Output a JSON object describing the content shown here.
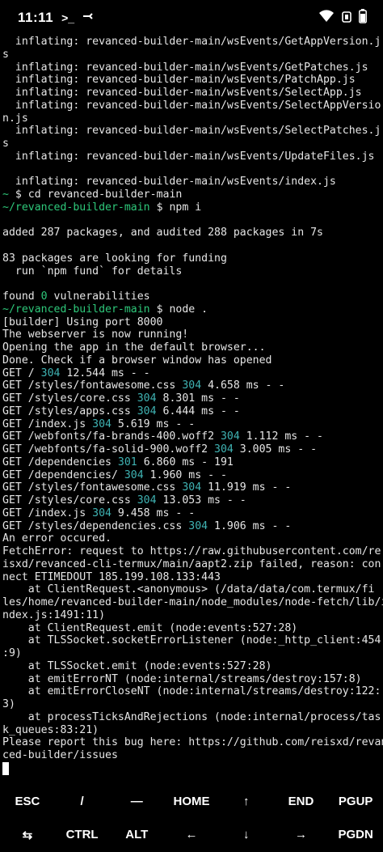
{
  "status_bar": {
    "time": "11:11",
    "indicators": ">_",
    "icons": [
      "terminal-icon",
      "cast-icon",
      "wifi-icon",
      "alarm-icon",
      "battery-icon"
    ]
  },
  "terminal": {
    "lines": [
      [
        {
          "t": "  inflating: revanced-builder-main/wsEvents/GetAppVersion.j"
        }
      ],
      [
        {
          "t": "s"
        }
      ],
      [
        {
          "t": "  inflating: revanced-builder-main/wsEvents/GetPatches.js"
        }
      ],
      [
        {
          "t": "  inflating: revanced-builder-main/wsEvents/PatchApp.js"
        }
      ],
      [
        {
          "t": "  inflating: revanced-builder-main/wsEvents/SelectApp.js"
        }
      ],
      [
        {
          "t": "  inflating: revanced-builder-main/wsEvents/SelectAppVersio"
        }
      ],
      [
        {
          "t": "n.js"
        }
      ],
      [
        {
          "t": "  inflating: revanced-builder-main/wsEvents/SelectPatches.j"
        }
      ],
      [
        {
          "t": "s"
        }
      ],
      [
        {
          "t": "  inflating: revanced-builder-main/wsEvents/UpdateFiles.js"
        }
      ],
      [
        {
          "t": ""
        }
      ],
      [
        {
          "t": "  inflating: revanced-builder-main/wsEvents/index.js"
        }
      ],
      [
        {
          "t": "~",
          "c": "green"
        },
        {
          "t": " $ cd revanced-builder-main"
        }
      ],
      [
        {
          "t": "~/revanced-builder-main",
          "c": "green"
        },
        {
          "t": " $ npm i"
        }
      ],
      [
        {
          "t": ""
        }
      ],
      [
        {
          "t": "added 287 packages, and audited 288 packages in 7s"
        }
      ],
      [
        {
          "t": ""
        }
      ],
      [
        {
          "t": "83 packages are looking for funding"
        }
      ],
      [
        {
          "t": "  run `npm fund` for details"
        }
      ],
      [
        {
          "t": ""
        }
      ],
      [
        {
          "t": "found "
        },
        {
          "t": "0",
          "c": "green"
        },
        {
          "t": " vulnerabilities"
        }
      ],
      [
        {
          "t": "~/revanced-builder-main",
          "c": "green"
        },
        {
          "t": " $ node ."
        }
      ],
      [
        {
          "t": "[builder] Using port 8000"
        }
      ],
      [
        {
          "t": "The webserver is now running!"
        }
      ],
      [
        {
          "t": "Opening the app in the default browser..."
        }
      ],
      [
        {
          "t": "Done. Check if a browser window has opened"
        }
      ],
      [
        {
          "t": "GET / "
        },
        {
          "t": "304",
          "c": "cyan"
        },
        {
          "t": " 12.544 ms - -"
        }
      ],
      [
        {
          "t": "GET /styles/fontawesome.css "
        },
        {
          "t": "304",
          "c": "cyan"
        },
        {
          "t": " 4.658 ms - -"
        }
      ],
      [
        {
          "t": "GET /styles/core.css "
        },
        {
          "t": "304",
          "c": "cyan"
        },
        {
          "t": " 8.301 ms - -"
        }
      ],
      [
        {
          "t": "GET /styles/apps.css "
        },
        {
          "t": "304",
          "c": "cyan"
        },
        {
          "t": " 6.444 ms - -"
        }
      ],
      [
        {
          "t": "GET /index.js "
        },
        {
          "t": "304",
          "c": "cyan"
        },
        {
          "t": " 5.619 ms - -"
        }
      ],
      [
        {
          "t": "GET /webfonts/fa-brands-400.woff2 "
        },
        {
          "t": "304",
          "c": "cyan"
        },
        {
          "t": " 1.112 ms - -"
        }
      ],
      [
        {
          "t": "GET /webfonts/fa-solid-900.woff2 "
        },
        {
          "t": "304",
          "c": "cyan"
        },
        {
          "t": " 3.005 ms - -"
        }
      ],
      [
        {
          "t": "GET /dependencies "
        },
        {
          "t": "301",
          "c": "cyan"
        },
        {
          "t": " 6.860 ms - 191"
        }
      ],
      [
        {
          "t": "GET /dependencies/ "
        },
        {
          "t": "304",
          "c": "cyan"
        },
        {
          "t": " 1.960 ms - -"
        }
      ],
      [
        {
          "t": "GET /styles/fontawesome.css "
        },
        {
          "t": "304",
          "c": "cyan"
        },
        {
          "t": " 11.919 ms - -"
        }
      ],
      [
        {
          "t": "GET /styles/core.css "
        },
        {
          "t": "304",
          "c": "cyan"
        },
        {
          "t": " 13.053 ms - -"
        }
      ],
      [
        {
          "t": "GET /index.js "
        },
        {
          "t": "304",
          "c": "cyan"
        },
        {
          "t": " 9.458 ms - -"
        }
      ],
      [
        {
          "t": "GET /styles/dependencies.css "
        },
        {
          "t": "304",
          "c": "cyan"
        },
        {
          "t": " 1.906 ms - -"
        }
      ],
      [
        {
          "t": "An error occured."
        }
      ],
      [
        {
          "t": "FetchError: request to https://raw.githubusercontent.com/re"
        }
      ],
      [
        {
          "t": "isxd/revanced-cli-termux/main/aapt2.zip failed, reason: con"
        }
      ],
      [
        {
          "t": "nect ETIMEDOUT 185.199.108.133:443"
        }
      ],
      [
        {
          "t": "    at ClientRequest.<anonymous> (/data/data/com.termux/fi"
        }
      ],
      [
        {
          "t": "les/home/revanced-builder-main/node_modules/node-fetch/lib/i"
        }
      ],
      [
        {
          "t": "ndex.js:1491:11)"
        }
      ],
      [
        {
          "t": "    at ClientRequest.emit (node:events:527:28)"
        }
      ],
      [
        {
          "t": "    at TLSSocket.socketErrorListener (node:_http_client:454"
        }
      ],
      [
        {
          "t": ":9)"
        }
      ],
      [
        {
          "t": "    at TLSSocket.emit (node:events:527:28)"
        }
      ],
      [
        {
          "t": "    at emitErrorNT (node:internal/streams/destroy:157:8)"
        }
      ],
      [
        {
          "t": "    at emitErrorCloseNT (node:internal/streams/destroy:122:"
        }
      ],
      [
        {
          "t": "3)"
        }
      ],
      [
        {
          "t": "    at processTicksAndRejections (node:internal/process/tas"
        }
      ],
      [
        {
          "t": "k_queues:83:21)"
        }
      ],
      [
        {
          "t": "Please report this bug here: https://github.com/reisxd/revan"
        }
      ],
      [
        {
          "t": "ced-builder/issues"
        }
      ]
    ]
  },
  "extra_keys": {
    "row1": [
      "ESC",
      "/",
      "—",
      "HOME",
      "↑",
      "END",
      "PGUP"
    ],
    "row2": [
      "⇆",
      "CTRL",
      "ALT",
      "←",
      "↓",
      "→",
      "PGDN"
    ]
  },
  "colors": {
    "prompt": "#2ec87a",
    "status_code": "#3fb3b3",
    "text": "#e6e6e6",
    "background": "#000000"
  }
}
